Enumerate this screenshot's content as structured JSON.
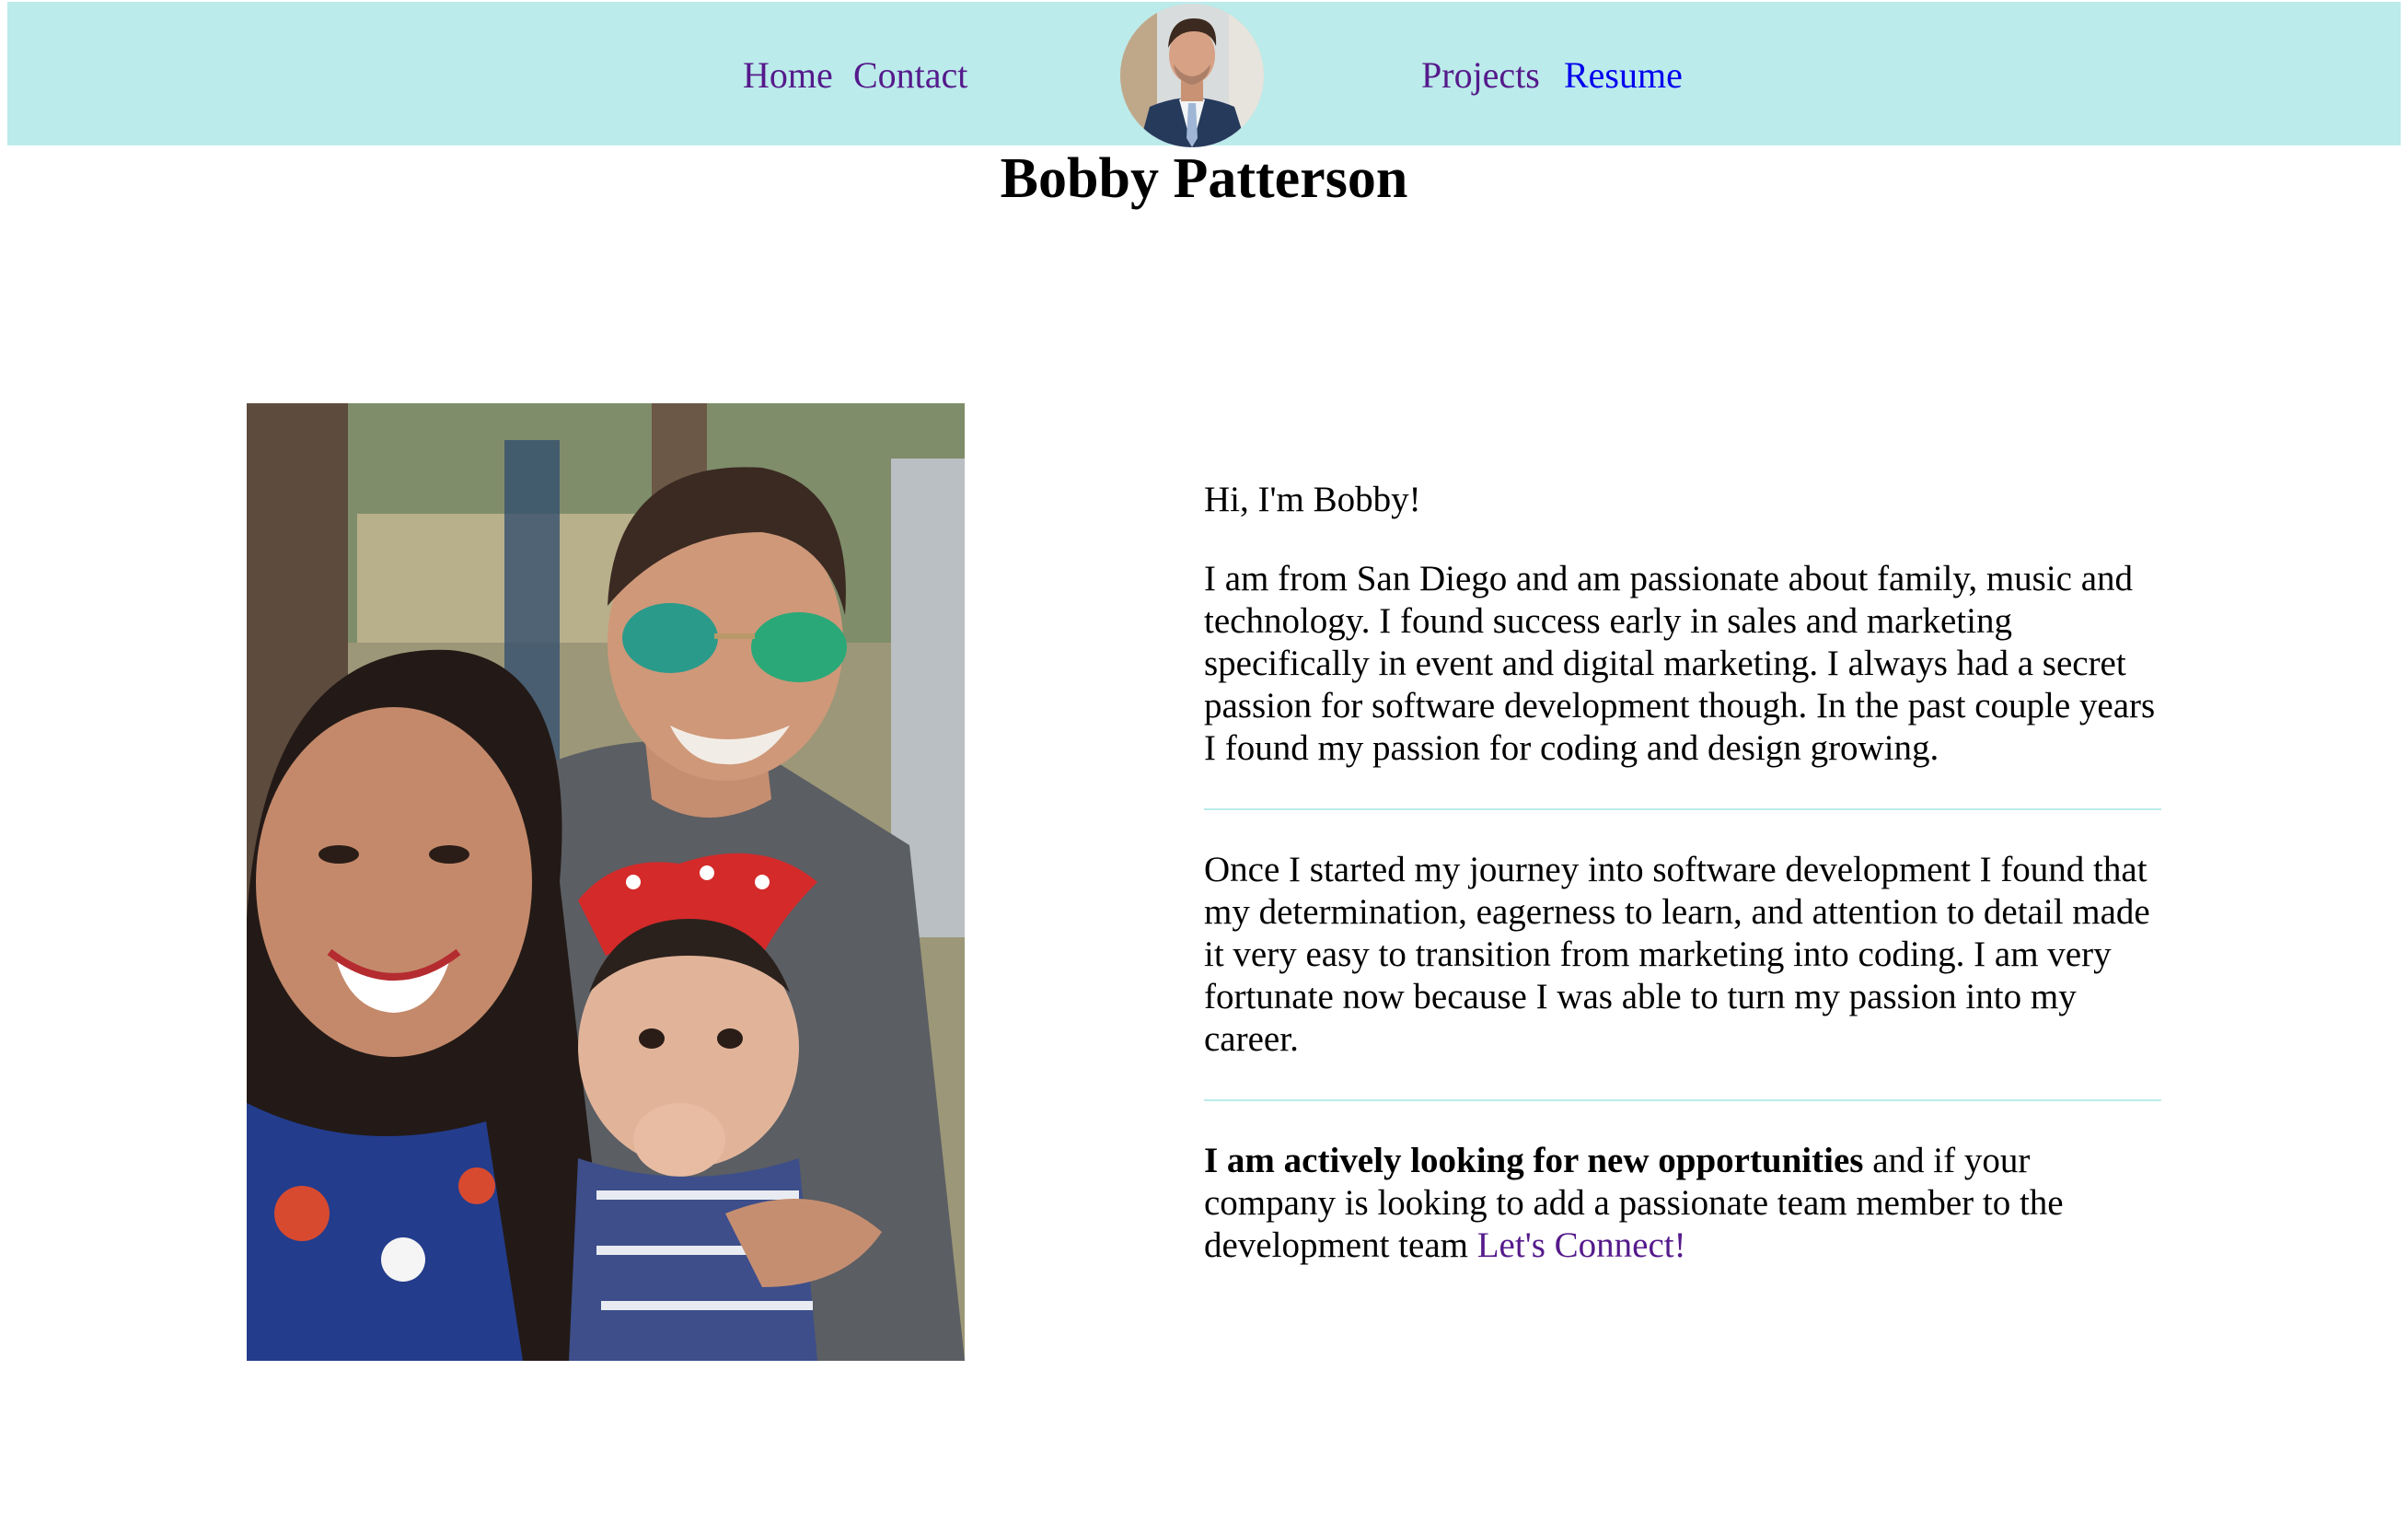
{
  "nav": {
    "home": "Home",
    "contact": "Contact",
    "projects": "Projects",
    "resume": "Resume"
  },
  "page_title": "Bobby Patterson",
  "bio": {
    "greeting": "Hi, I'm Bobby!",
    "paragraph_1": "I am from San Diego and am passionate about family, music and technology. I found success early in sales and marketing specifically in event and digital marketing. I always had a secret passion for software development though. In the past couple years I found my passion for coding and design growing.",
    "paragraph_2": "Once I started my journey into software development I found that my determination, eagerness to learn, and attention to detail made it very easy to transition from marketing into coding. I am very fortunate now because I was able to turn my passion into my career.",
    "paragraph_3_bold": "I am actively looking for new opportunities",
    "paragraph_3_rest": " and if your company is looking to add a passionate team member to the development team ",
    "connect_link": "Let's Connect!"
  },
  "colors": {
    "header_background": "#bbebeb",
    "visited_link": "#551a8b",
    "unvisited_link": "#0000ee",
    "divider": "#bbebeb"
  }
}
